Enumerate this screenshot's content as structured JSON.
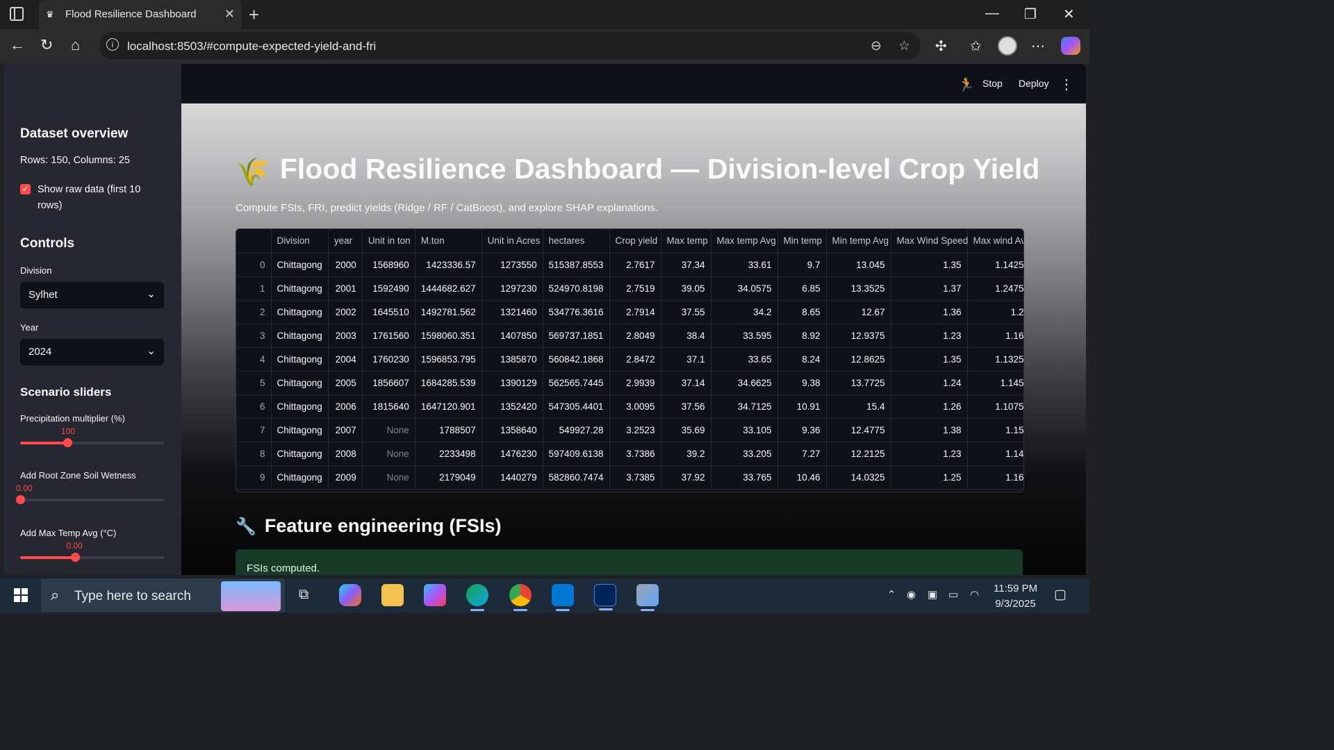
{
  "browser": {
    "tab_title": "Flood Resilience Dashboard",
    "url": "localhost:8503/#compute-expected-yield-and-fri"
  },
  "streamlit": {
    "stop_label": "Stop",
    "deploy_label": "Deploy"
  },
  "sidebar": {
    "dataset_heading": "Dataset overview",
    "rows_cols": "Rows: 150, Columns: 25",
    "show_raw_label": "Show raw data (first 10 rows)",
    "show_raw_checked": true,
    "controls_heading": "Controls",
    "division_label": "Division",
    "division_value": "Sylhet",
    "year_label": "Year",
    "year_value": "2024",
    "sliders_heading": "Scenario sliders",
    "sliders": [
      {
        "label": "Precipitation multiplier (%)",
        "value": "100",
        "fraction": 0.33
      },
      {
        "label": "Add Root Zone Soil Wetness",
        "value": "0.00",
        "fraction": 0.0
      },
      {
        "label": "Add Max Temp Avg (°C)",
        "value": "0.00",
        "fraction": 0.38
      }
    ]
  },
  "main": {
    "title": "Flood Resilience Dashboard — Division-level Crop Yield",
    "title_icon": "🌾",
    "subtitle": "Compute FSIs, FRI, predict yields (Ridge / RF / CatBoost), and explore SHAP explanations.",
    "section_heading": "Feature engineering (FSIs)",
    "section_icon": "🔧",
    "success_message": "FSIs computed."
  },
  "table": {
    "columns": [
      "",
      "Division",
      "year",
      "Unit in ton",
      "M.ton",
      "Unit in Acres",
      "hectares",
      "Crop yield",
      "Max temp",
      "Max temp Avg",
      "Min temp",
      "Min temp Avg",
      "Max Wind Speed",
      "Max wind Avg"
    ],
    "rows": [
      [
        "0",
        "Chittagong",
        "2000",
        "1568960",
        "1423336.57",
        "1273550",
        "515387.8553",
        "2.7617",
        "37.34",
        "33.61",
        "9.7",
        "13.045",
        "1.35",
        "1.1425"
      ],
      [
        "1",
        "Chittagong",
        "2001",
        "1592490",
        "1444682.627",
        "1297230",
        "524970.8198",
        "2.7519",
        "39.05",
        "34.0575",
        "6.85",
        "13.3525",
        "1.37",
        "1.2475"
      ],
      [
        "2",
        "Chittagong",
        "2002",
        "1645510",
        "1492781.562",
        "1321460",
        "534776.3616",
        "2.7914",
        "37.55",
        "34.2",
        "8.65",
        "12.67",
        "1.36",
        "1.2"
      ],
      [
        "3",
        "Chittagong",
        "2003",
        "1761560",
        "1598060.351",
        "1407850",
        "569737.1851",
        "2.8049",
        "38.4",
        "33.595",
        "8.92",
        "12.9375",
        "1.23",
        "1.16"
      ],
      [
        "4",
        "Chittagong",
        "2004",
        "1760230",
        "1596853.795",
        "1385870",
        "560842.1868",
        "2.8472",
        "37.1",
        "33.65",
        "8.24",
        "12.8625",
        "1.35",
        "1.1325"
      ],
      [
        "5",
        "Chittagong",
        "2005",
        "1856607",
        "1684285.539",
        "1390129",
        "562565.7445",
        "2.9939",
        "37.14",
        "34.6625",
        "9.38",
        "13.7725",
        "1.24",
        "1.145"
      ],
      [
        "6",
        "Chittagong",
        "2006",
        "1815640",
        "1647120.901",
        "1352420",
        "547305.4401",
        "3.0095",
        "37.56",
        "34.7125",
        "10.91",
        "15.4",
        "1.26",
        "1.1075"
      ],
      [
        "7",
        "Chittagong",
        "2007",
        "None",
        "1788507",
        "1358640",
        "549927.28",
        "3.2523",
        "35.69",
        "33.105",
        "9.36",
        "12.4775",
        "1.38",
        "1.15"
      ],
      [
        "8",
        "Chittagong",
        "2008",
        "None",
        "2233498",
        "1476230",
        "597409.6138",
        "3.7386",
        "39.2",
        "33.205",
        "7.27",
        "12.2125",
        "1.23",
        "1.14"
      ],
      [
        "9",
        "Chittagong",
        "2009",
        "None",
        "2179049",
        "1440279",
        "582860.7474",
        "3.7385",
        "37.92",
        "33.765",
        "10.46",
        "14.0325",
        "1.25",
        "1.16"
      ]
    ]
  },
  "taskbar": {
    "search_placeholder": "Type here to search",
    "time": "11:59 PM",
    "date": "9/3/2025"
  }
}
